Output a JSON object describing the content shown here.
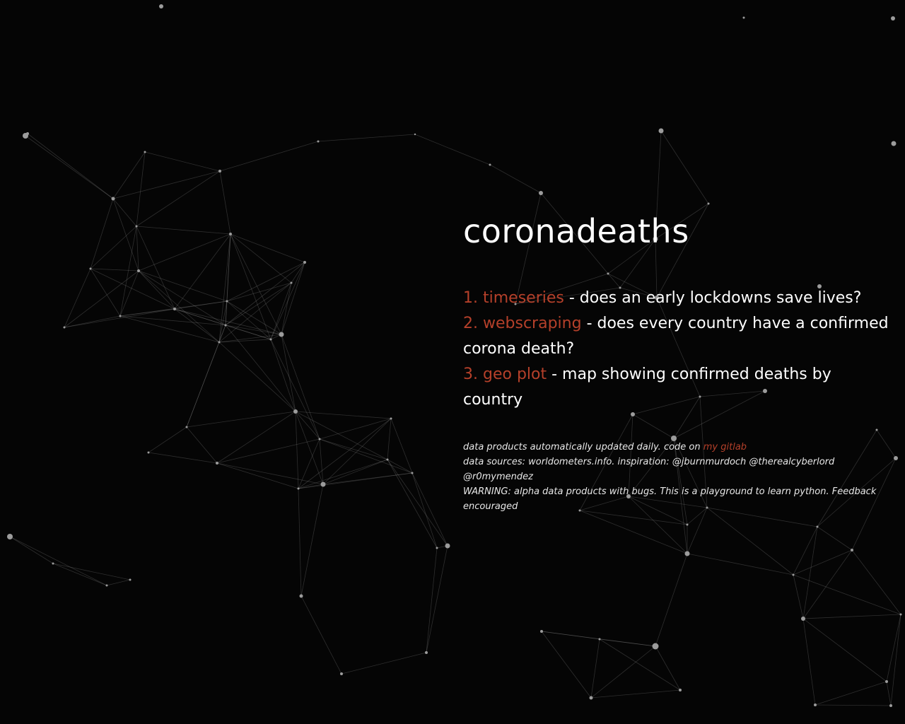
{
  "title": "coronadeaths",
  "projects": [
    {
      "number": "1.",
      "link_label": "timeseries",
      "description": " - does an early lockdowns save lives?"
    },
    {
      "number": "2.",
      "link_label": "webscraping",
      "description": " - does every country have a confirmed corona death?"
    },
    {
      "number": "3.",
      "link_label": "geo plot",
      "description": " - map showing confirmed deaths by country"
    }
  ],
  "info": {
    "updated_text": "data products automatically updated daily. code on ",
    "gitlab_label": "my gitlab",
    "sources_text": "data sources: worldometers.info. inspiration: @jburnmurdoch @therealcyberlord @r0mymendez",
    "warning_text": "WARNING: alpha data products with bugs. This is a playground to learn python. Feedback encouraged"
  },
  "colors": {
    "background": "#050505",
    "link_accent": "#b5402a",
    "text": "#ffffff",
    "network": "#9c9c9c"
  }
}
